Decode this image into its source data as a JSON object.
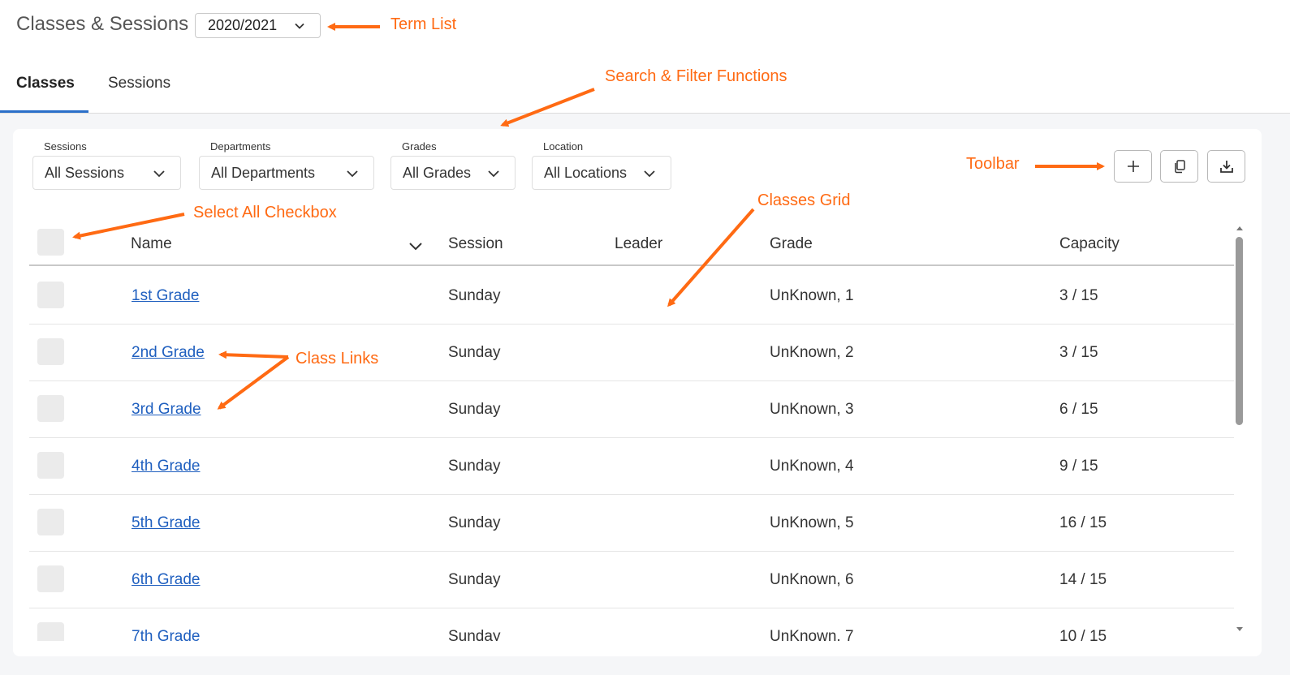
{
  "header": {
    "title": "Classes & Sessions",
    "term_value": "2020/2021"
  },
  "tabs": [
    {
      "label": "Classes",
      "active": true
    },
    {
      "label": "Sessions",
      "active": false
    }
  ],
  "filters": {
    "sessions": {
      "label": "Sessions",
      "value": "All Sessions"
    },
    "departments": {
      "label": "Departments",
      "value": "All Departments"
    },
    "grades": {
      "label": "Grades",
      "value": "All Grades"
    },
    "location": {
      "label": "Location",
      "value": "All Locations"
    }
  },
  "toolbar": {
    "buttons": [
      {
        "icon": "plus-icon"
      },
      {
        "icon": "copy-icon"
      },
      {
        "icon": "download-icon"
      }
    ]
  },
  "grid": {
    "columns": [
      "Name",
      "Session",
      "Leader",
      "Grade",
      "Capacity"
    ],
    "rows": [
      {
        "name": "1st Grade",
        "session": "Sunday",
        "leader": "",
        "grade": "UnKnown, 1",
        "capacity": "3 / 15"
      },
      {
        "name": "2nd Grade",
        "session": "Sunday",
        "leader": "",
        "grade": "UnKnown, 2",
        "capacity": "3 / 15"
      },
      {
        "name": "3rd Grade",
        "session": "Sunday",
        "leader": "",
        "grade": "UnKnown, 3",
        "capacity": "6 / 15"
      },
      {
        "name": "4th Grade",
        "session": "Sunday",
        "leader": "",
        "grade": "UnKnown, 4",
        "capacity": "9 / 15"
      },
      {
        "name": "5th Grade",
        "session": "Sunday",
        "leader": "",
        "grade": "UnKnown, 5",
        "capacity": "16 / 15"
      },
      {
        "name": "6th Grade",
        "session": "Sunday",
        "leader": "",
        "grade": "UnKnown, 6",
        "capacity": "14 / 15"
      },
      {
        "name": "7th Grade",
        "session": "Sunday",
        "leader": "",
        "grade": "UnKnown, 7",
        "capacity": "10 / 15"
      }
    ]
  },
  "annotations": {
    "term_list": "Term List",
    "search_filter": "Search & Filter Functions",
    "toolbar": "Toolbar",
    "classes_grid": "Classes Grid",
    "select_all": "Select All Checkbox",
    "class_links": "Class Links"
  },
  "colors": {
    "accent": "#2a6fc9",
    "link": "#1f5fbf",
    "annotation": "#ff6a13"
  }
}
